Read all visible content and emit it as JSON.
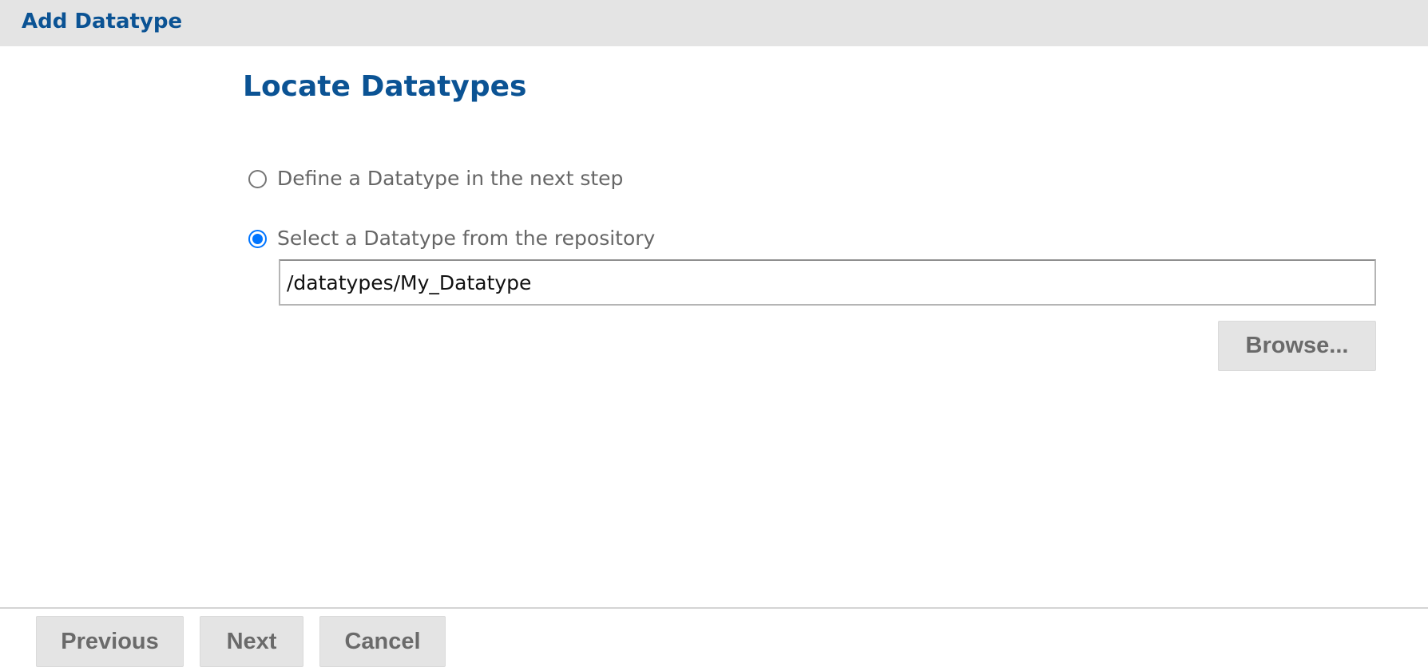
{
  "window": {
    "title": "Add Datatype"
  },
  "main": {
    "heading": "Locate Datatypes",
    "options": [
      {
        "label": "Define a Datatype in the next step",
        "selected": false
      },
      {
        "label": "Select a Datatype from the repository",
        "selected": true
      }
    ],
    "path_value": "/datatypes/My_Datatype",
    "browse_label": "Browse..."
  },
  "footer": {
    "previous_label": "Previous",
    "next_label": "Next",
    "cancel_label": "Cancel"
  },
  "colors": {
    "accent": "#0b5394",
    "radio_selected": "#0075ff",
    "button_bg": "#e4e4e4"
  }
}
